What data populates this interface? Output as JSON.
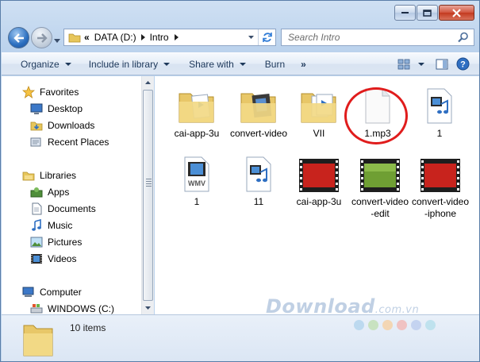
{
  "window": {
    "address": {
      "overflow": "«",
      "segments": [
        "DATA (D:)",
        "Intro"
      ]
    },
    "search": {
      "placeholder": "Search Intro"
    }
  },
  "toolbar": {
    "organize": "Organize",
    "include_in_library": "Include in library",
    "share_with": "Share with",
    "burn": "Burn",
    "more": "»"
  },
  "nav": {
    "favorites": {
      "label": "Favorites",
      "items": [
        "Desktop",
        "Downloads",
        "Recent Places"
      ]
    },
    "libraries": {
      "label": "Libraries",
      "items": [
        "Apps",
        "Documents",
        "Music",
        "Pictures",
        "Videos"
      ]
    },
    "computer": {
      "label": "Computer",
      "items": [
        "WINDOWS (C:)"
      ]
    }
  },
  "files": [
    {
      "name": "cai-app-3u",
      "icon": "folder-with-media-icon"
    },
    {
      "name": "convert-video",
      "icon": "folder-with-media-icon"
    },
    {
      "name": "VII",
      "icon": "folder-with-media-icon"
    },
    {
      "name": "1.mp3",
      "icon": "blank-file-icon"
    },
    {
      "name": "1",
      "icon": "media-file-icon"
    },
    {
      "name": "1",
      "icon": "wmv-file-icon"
    },
    {
      "name": "11",
      "icon": "media-file-icon"
    },
    {
      "name": "cai-app-3u",
      "icon": "red-video-thumbnail"
    },
    {
      "name": "convert-video-edit",
      "icon": "green-video-thumbnail"
    },
    {
      "name": "convert-video-iphone",
      "icon": "red-video-thumbnail"
    }
  ],
  "status": {
    "item_count": "10 items"
  },
  "watermark": {
    "main": "Download",
    "suffix": ".com.vn"
  },
  "colors": {
    "highlight": "#e01c1c",
    "accent": "#1e395b"
  }
}
